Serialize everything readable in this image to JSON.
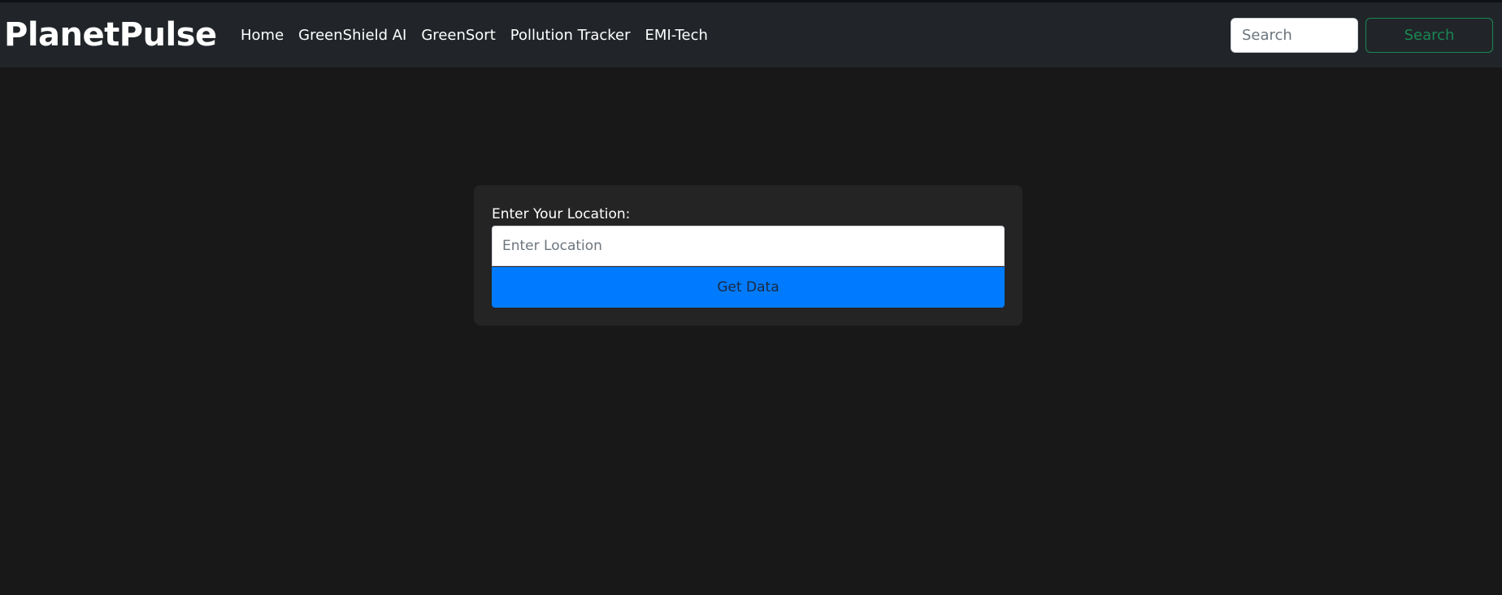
{
  "navbar": {
    "brand": "PlanetPulse",
    "links": [
      {
        "label": "Home"
      },
      {
        "label": "GreenShield AI"
      },
      {
        "label": "GreenSort"
      },
      {
        "label": "Pollution Tracker"
      },
      {
        "label": "EMI-Tech"
      }
    ],
    "search": {
      "placeholder": "Search",
      "value": "",
      "button_label": "Search"
    }
  },
  "location_form": {
    "label": "Enter Your Location:",
    "input_placeholder": "Enter Location",
    "input_value": "",
    "button_label": "Get Data"
  },
  "colors": {
    "page_background": "#181818",
    "navbar_background": "#212529",
    "card_background": "#242424",
    "primary_button": "#007bff",
    "search_outline": "#198754"
  }
}
